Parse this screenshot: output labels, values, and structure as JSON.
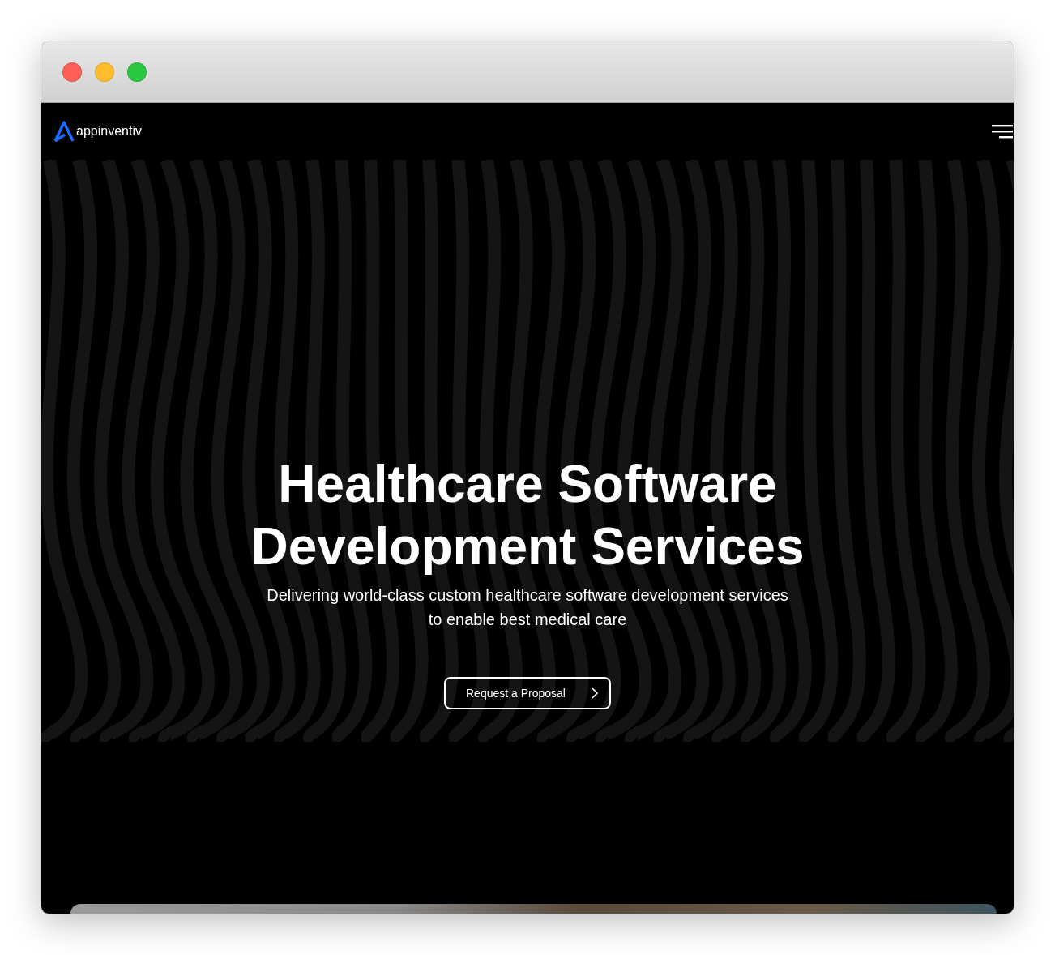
{
  "window": {
    "controls": [
      {
        "kind": "close"
      },
      {
        "kind": "minimize"
      },
      {
        "kind": "zoom"
      }
    ]
  },
  "navbar": {
    "logo_text": "appinventiv"
  },
  "hero": {
    "title_lines": [
      "Healthcare Software",
      "Development Services"
    ],
    "subtitle_lines": [
      "Delivering world-class custom healthcare software development services",
      "to enable best medical care"
    ],
    "button": {
      "label": "Request a Proposal"
    }
  }
}
